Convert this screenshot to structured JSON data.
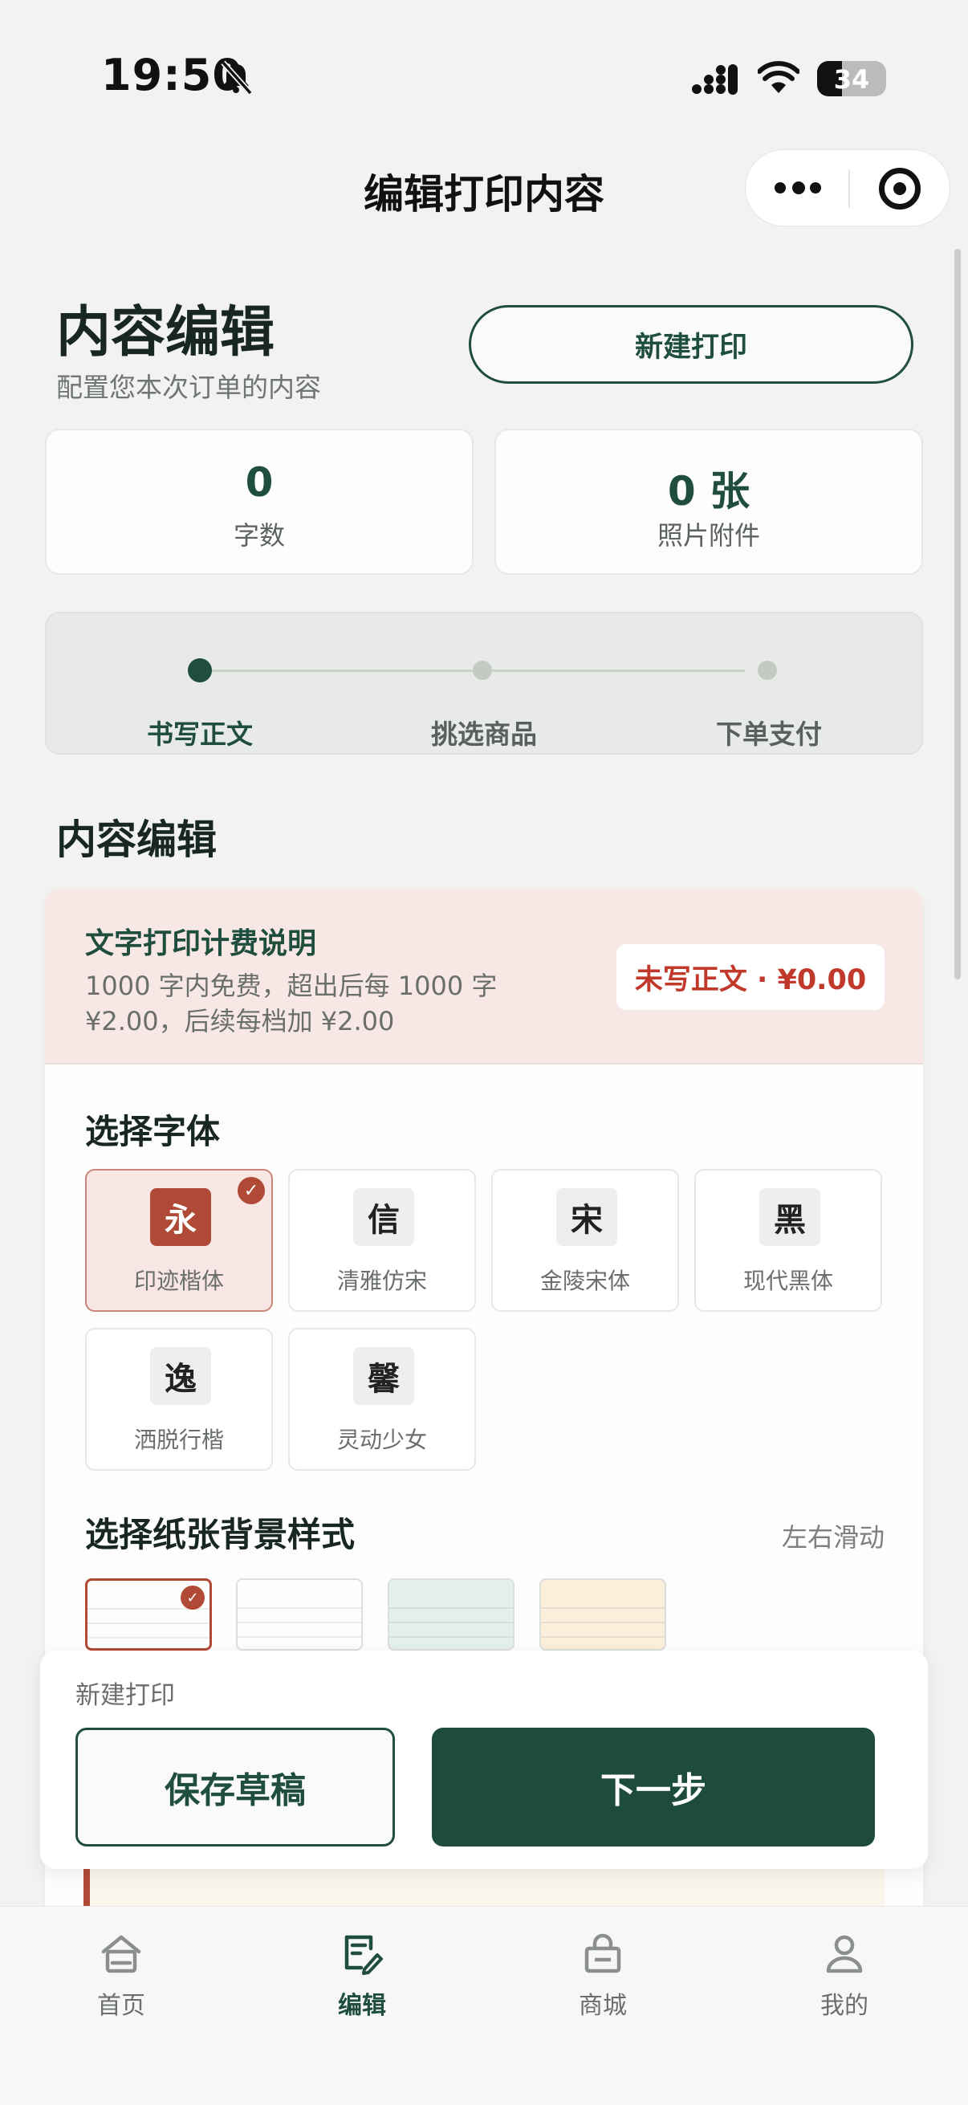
{
  "status_bar": {
    "time": "19:50",
    "battery": "34"
  },
  "nav": {
    "title": "编辑打印内容"
  },
  "header": {
    "title": "内容编辑",
    "subtitle": "配置您本次订单的内容",
    "new_print_label": "新建打印"
  },
  "stats": [
    {
      "value": "0",
      "label": "字数"
    },
    {
      "value": "0 张",
      "label": "照片附件"
    }
  ],
  "steps": [
    {
      "label": "书写正文",
      "active": true
    },
    {
      "label": "挑选商品",
      "active": false
    },
    {
      "label": "下单支付",
      "active": false
    }
  ],
  "section_title": "内容编辑",
  "fee": {
    "title": "文字打印计费说明",
    "description": "1000 字内免费，超出后每 1000 字 ¥2.00，后续每档加 ¥2.00",
    "badge": "未写正文 · ¥0.00"
  },
  "fonts": {
    "title": "选择字体",
    "items": [
      {
        "glyph": "永",
        "name": "印迹楷体",
        "selected": true
      },
      {
        "glyph": "信",
        "name": "清雅仿宋",
        "selected": false
      },
      {
        "glyph": "宋",
        "name": "金陵宋体",
        "selected": false
      },
      {
        "glyph": "黑",
        "name": "现代黑体",
        "selected": false
      },
      {
        "glyph": "逸",
        "name": "洒脱行楷",
        "selected": false
      },
      {
        "glyph": "馨",
        "name": "灵动少女",
        "selected": false
      }
    ]
  },
  "backgrounds": {
    "title": "选择纸张背景样式",
    "hint": "左右滑动",
    "colors": [
      "#ffffff",
      "#ffffff",
      "#e3f0ea",
      "#fbefdc"
    ]
  },
  "action_panel": {
    "label": "新建打印",
    "save_label": "保存草稿",
    "next_label": "下一步"
  },
  "tabbar": [
    {
      "label": "首页",
      "icon": "home-icon",
      "active": false
    },
    {
      "label": "编辑",
      "icon": "edit-icon",
      "active": true
    },
    {
      "label": "商城",
      "icon": "shop-bag-icon",
      "active": false
    },
    {
      "label": "我的",
      "icon": "user-icon",
      "active": false
    }
  ],
  "colors": {
    "primary": "#1f4d3e",
    "accent": "#b04a36",
    "price": "#c0392b"
  }
}
